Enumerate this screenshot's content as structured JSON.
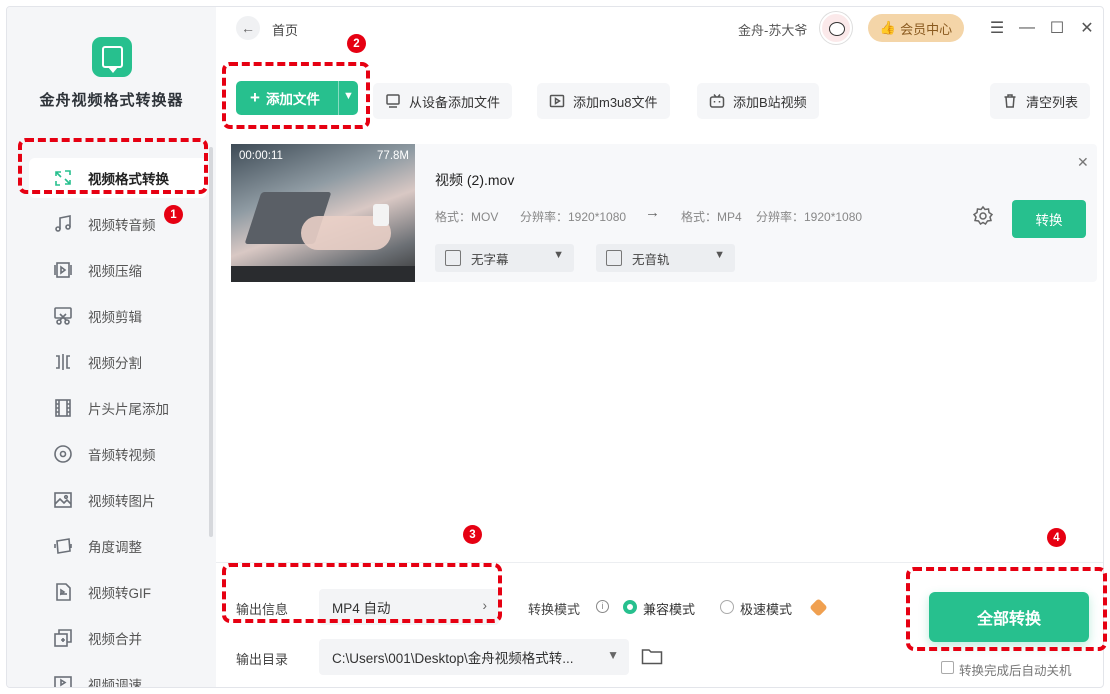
{
  "app": {
    "title": "金舟视频格式转换器",
    "accent": "#27c08e"
  },
  "sidebar": {
    "items": [
      {
        "label": "视频格式转换",
        "icon": "convert-icon",
        "active": true
      },
      {
        "label": "视频转音频",
        "icon": "music-note-icon"
      },
      {
        "label": "视频压缩",
        "icon": "compress-icon"
      },
      {
        "label": "视频剪辑",
        "icon": "scissors-icon"
      },
      {
        "label": "视频分割",
        "icon": "split-icon"
      },
      {
        "label": "片头片尾添加",
        "icon": "film-icon"
      },
      {
        "label": "音频转视频",
        "icon": "disc-icon"
      },
      {
        "label": "视频转图片",
        "icon": "image-icon"
      },
      {
        "label": "角度调整",
        "icon": "rotate-icon"
      },
      {
        "label": "视频转GIF",
        "icon": "gif-icon"
      },
      {
        "label": "视频合并",
        "icon": "merge-icon"
      },
      {
        "label": "视频调速",
        "icon": "speed-icon"
      }
    ]
  },
  "topbar": {
    "breadcrumb": "首页",
    "username": "金舟-苏大爷",
    "vip_label": "会员中心"
  },
  "toolbar": {
    "add_file": "添加文件",
    "add_from_device": "从设备添加文件",
    "add_m3u8": "添加m3u8文件",
    "add_bilibili": "添加B站视频",
    "clear_list": "清空列表"
  },
  "file": {
    "duration": "00:00:11",
    "size": "77.8M",
    "name": "视频 (2).mov",
    "src_format": "格式：MOV",
    "src_resolution": "分辨率：1920*1080",
    "dst_format": "格式：MP4",
    "dst_resolution": "分辨率：1920*1080",
    "subtitle": "无字幕",
    "audio_track": "无音轨",
    "convert": "转换"
  },
  "output": {
    "info_label": "输出信息",
    "format_value": "MP4 自动",
    "mode_label": "转换模式",
    "mode_compatible": "兼容模式",
    "mode_fast": "极速模式",
    "dir_label": "输出目录",
    "dir_value": "C:\\Users\\001\\Desktop\\金舟视频格式转...",
    "convert_all": "全部转换",
    "auto_shutdown": "转换完成后自动关机"
  },
  "annotations": [
    "1",
    "2",
    "3",
    "4"
  ]
}
